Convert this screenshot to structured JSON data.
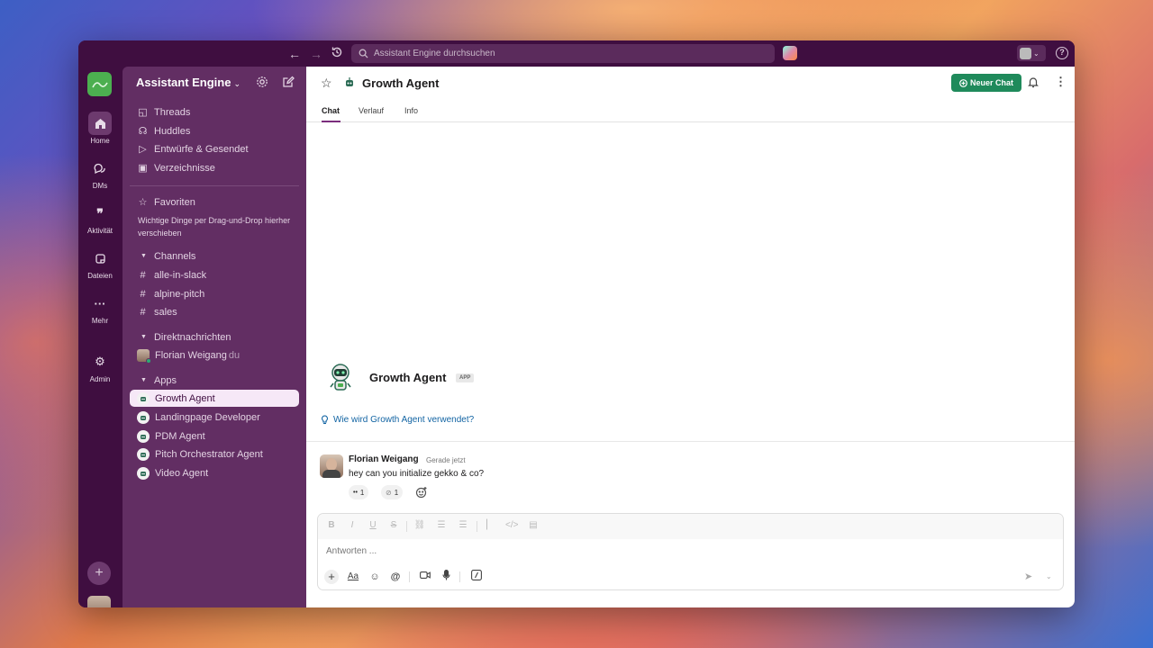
{
  "titlebar": {
    "search_placeholder": "Assistant Engine durchsuchen"
  },
  "rail": {
    "items": [
      {
        "label": "Home"
      },
      {
        "label": "DMs"
      },
      {
        "label": "Aktivität"
      },
      {
        "label": "Dateien"
      },
      {
        "label": "Mehr"
      },
      {
        "label": "Admin"
      }
    ]
  },
  "sidebar": {
    "workspace_name": "Assistant Engine",
    "nav": [
      {
        "label": "Threads",
        "icon": "threads-icon"
      },
      {
        "label": "Huddles",
        "icon": "headphones-icon"
      },
      {
        "label": "Entwürfe & Gesendet",
        "icon": "send-icon"
      },
      {
        "label": "Verzeichnisse",
        "icon": "directory-icon"
      }
    ],
    "favorites_label": "Favoriten",
    "favorites_hint": "Wichtige Dinge per Drag-und-Drop hierher verschieben",
    "channels_label": "Channels",
    "channels": [
      "alle-in-slack",
      "alpine-pitch",
      "sales"
    ],
    "dm_label": "Direktnachrichten",
    "dm_user": "Florian Weigang",
    "dm_you": "du",
    "apps_label": "Apps",
    "apps": [
      "Growth Agent",
      "Landingpage Developer",
      "PDM Agent",
      "Pitch Orchestrator Agent",
      "Video Agent"
    ],
    "active_app": "Growth Agent"
  },
  "header": {
    "title": "Growth Agent",
    "new_chat": "Neuer Chat",
    "tabs": [
      "Chat",
      "Verlauf",
      "Info"
    ]
  },
  "intro": {
    "name": "Growth Agent",
    "badge": "APP",
    "hint": "Wie wird Growth Agent verwendet?"
  },
  "message": {
    "author": "Florian Weigang",
    "time": "Gerade jetzt",
    "text": "hey can you initialize gekko & co?",
    "reactions": [
      {
        "emoji": "••",
        "count": "1"
      },
      {
        "emoji": "⊘",
        "count": "1"
      }
    ]
  },
  "composer": {
    "placeholder": "Antworten ..."
  },
  "colors": {
    "aubergine": "#3f0e40",
    "sidebar": "#622e63",
    "accent_green": "#1f8a5b",
    "link": "#1264a3"
  }
}
